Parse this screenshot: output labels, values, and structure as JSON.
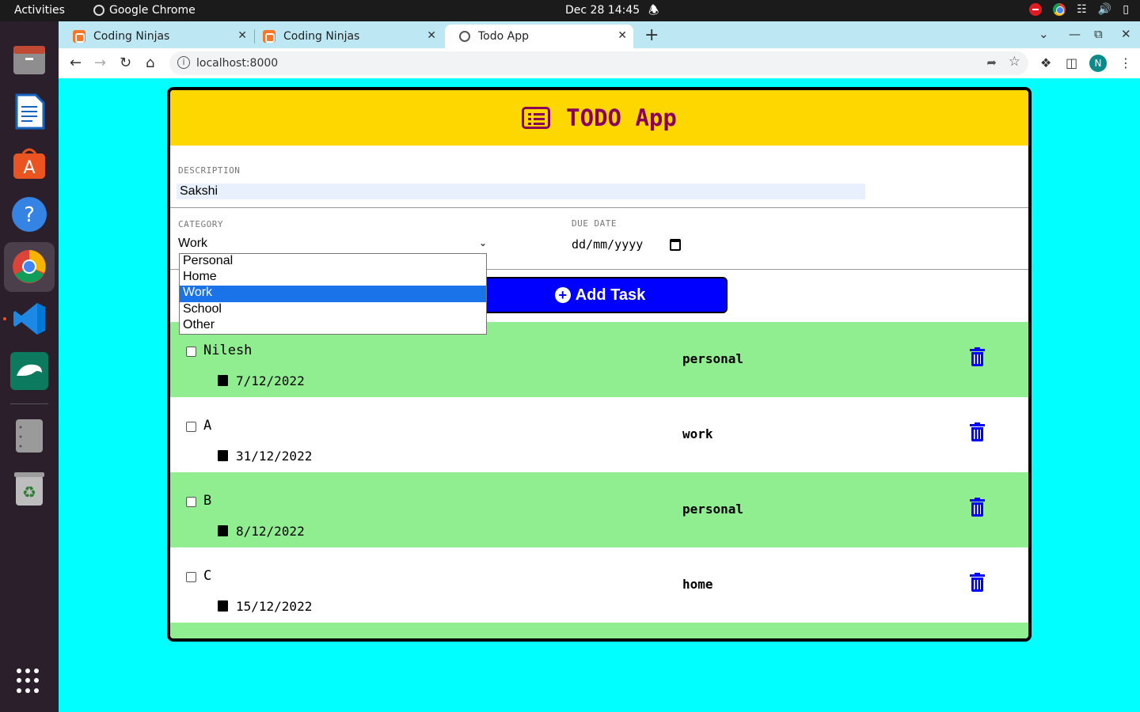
{
  "system_bar": {
    "activities": "Activities",
    "app_name": "Google Chrome",
    "clock": "Dec 28  14:45"
  },
  "dock": {
    "items": [
      "files-icon",
      "writer-icon",
      "software-icon",
      "help-icon",
      "chrome-icon",
      "vscode-icon",
      "mysql-workbench-icon",
      "server-icon",
      "trash-icon"
    ]
  },
  "browser": {
    "tabs": [
      {
        "label": "Coding Ninjas",
        "active": false
      },
      {
        "label": "Coding Ninjas",
        "active": false
      },
      {
        "label": "Todo App",
        "active": true
      }
    ],
    "url": "localhost:8000",
    "profile_initial": "N"
  },
  "app": {
    "title": "TODO App",
    "description_label": "DESCRIPTION",
    "description_value": "Sakshi",
    "category_label": "CATEGORY",
    "category_value": "Work",
    "due_date_label": "DUE DATE",
    "due_date_placeholder": "dd/mm/yyyy",
    "add_button": "Add Task",
    "category_options": [
      "Personal",
      "Home",
      "Work",
      "School",
      "Other"
    ],
    "selected_option_index": 2,
    "tasks": [
      {
        "title": "Nilesh",
        "date": "7/12/2022",
        "category": "personal",
        "highlight": true
      },
      {
        "title": "A",
        "date": "31/12/2022",
        "category": "work",
        "highlight": false
      },
      {
        "title": "B",
        "date": "8/12/2022",
        "category": "personal",
        "highlight": true
      },
      {
        "title": "C",
        "date": "15/12/2022",
        "category": "home",
        "highlight": false
      }
    ]
  },
  "colors": {
    "page_bg": "#00ffff",
    "header_bg": "#ffd700",
    "title_color": "#8b0057",
    "button_bg": "#0000ff",
    "highlight_row": "#90ee90"
  }
}
